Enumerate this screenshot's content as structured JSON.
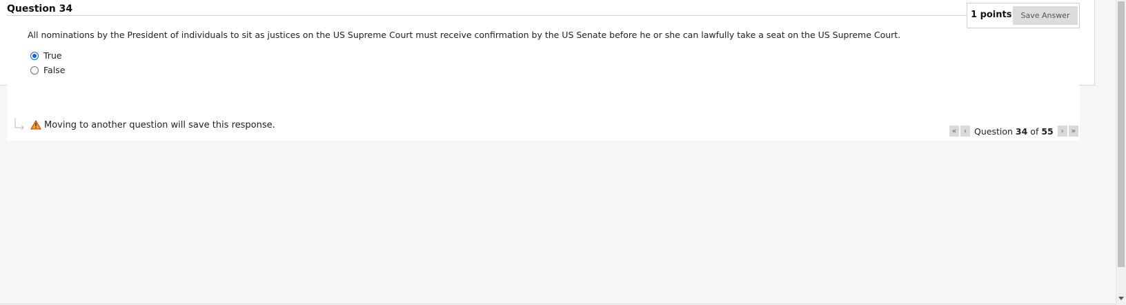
{
  "question": {
    "title": "Question 34",
    "points_label": "1 points",
    "save_button": "Save Answer",
    "prompt": "All nominations by the President of individuals to sit as justices on the US Supreme Court must receive confirmation by the US Senate before he or she can lawfully take a seat on the US Supreme Court.",
    "options": [
      {
        "label": "True",
        "selected": true
      },
      {
        "label": "False",
        "selected": false
      }
    ]
  },
  "footer": {
    "notice": "Moving to another question will save this response."
  },
  "pager": {
    "prefix": "Question",
    "current": "34",
    "of_text": "of",
    "total": "55",
    "first_icon": "double-chevron-left-icon",
    "prev_icon": "chevron-left-icon",
    "next_icon": "chevron-right-icon",
    "last_icon": "double-chevron-right-icon"
  },
  "icons": {
    "warning": "warning-icon",
    "arrow": "corner-arrow-icon"
  },
  "colors": {
    "radio_selected": "#0b62e6",
    "warning_fill": "#f2a900",
    "warning_outline": "#d9230f"
  }
}
